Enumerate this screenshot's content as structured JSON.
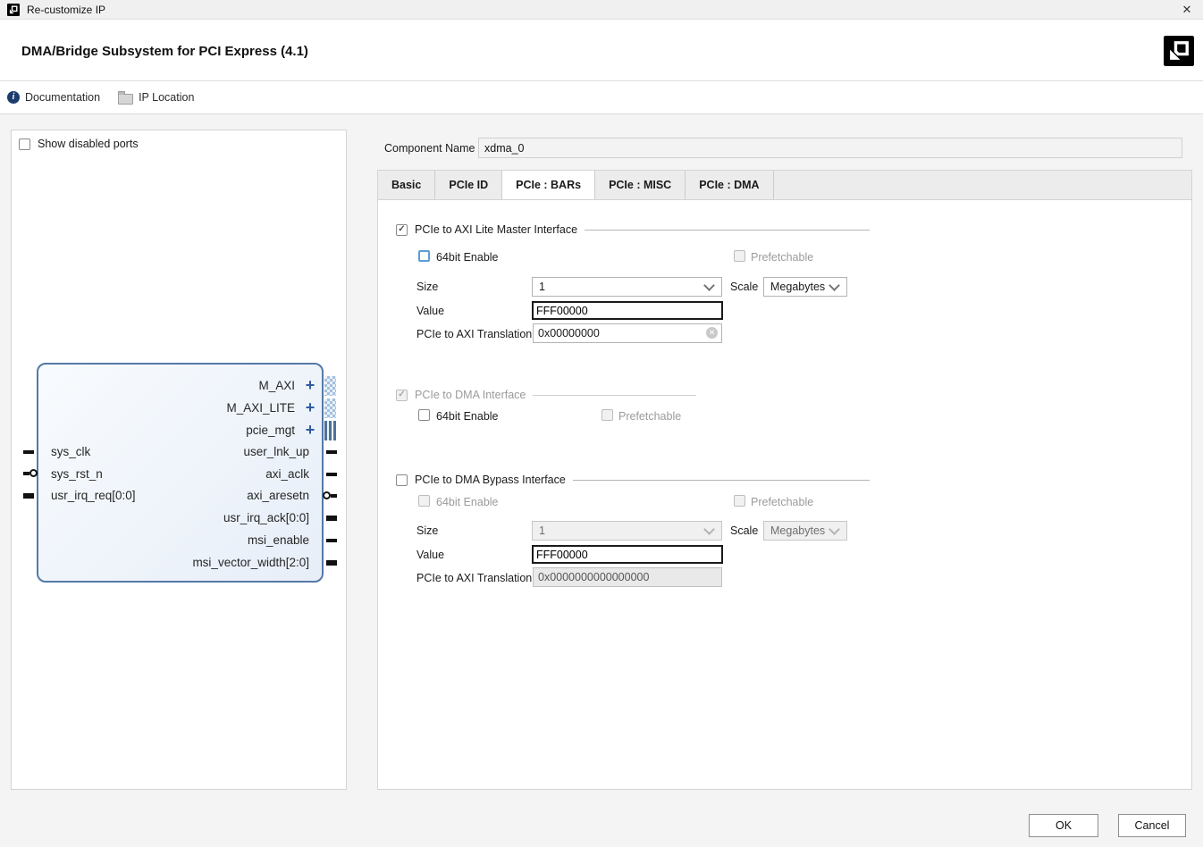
{
  "window": {
    "title": "Re-customize IP"
  },
  "header": {
    "title": "DMA/Bridge Subsystem for PCI Express (4.1)"
  },
  "toolbar": {
    "documentation": "Documentation",
    "ip_location": "IP Location"
  },
  "left_panel": {
    "show_disabled_ports": "Show disabled ports",
    "block": {
      "interfaces": [
        {
          "label": "M_AXI",
          "pin_icon": "interface-pins-dotted"
        },
        {
          "label": "M_AXI_LITE",
          "pin_icon": "interface-pins-dotted"
        },
        {
          "label": "pcie_mgt",
          "pin_icon": "interface-pins-bars"
        }
      ],
      "left_ports": [
        {
          "label": "sys_clk",
          "style": "thin"
        },
        {
          "label": "sys_rst_n",
          "style": "active-low"
        },
        {
          "label": "usr_irq_req[0:0]",
          "style": "bus"
        }
      ],
      "right_ports": [
        {
          "label": "user_lnk_up",
          "style": "thin"
        },
        {
          "label": "axi_aclk",
          "style": "thin"
        },
        {
          "label": "axi_aresetn",
          "style": "active-low"
        },
        {
          "label": "usr_irq_ack[0:0]",
          "style": "bus"
        },
        {
          "label": "msi_enable",
          "style": "thin"
        },
        {
          "label": "msi_vector_width[2:0]",
          "style": "bus"
        }
      ]
    }
  },
  "component_name": {
    "label": "Component Name",
    "value": "xdma_0"
  },
  "tabs": [
    {
      "label": "Basic",
      "selected": false
    },
    {
      "label": "PCIe ID",
      "selected": false
    },
    {
      "label": "PCIe : BARs",
      "selected": true
    },
    {
      "label": "PCIe : MISC",
      "selected": false
    },
    {
      "label": "PCIe : DMA",
      "selected": false
    }
  ],
  "sections": [
    {
      "title": "PCIe to AXI Lite Master Interface",
      "checkbox_state": "checked",
      "bit64_label": "64bit Enable",
      "prefetchable_label": "Prefetchable",
      "size_label": "Size",
      "size_value": "1",
      "scale_label": "Scale",
      "scale_value": "Megabytes",
      "value_label": "Value",
      "value": "FFF00000",
      "translation_label": "PCIe to AXI Translation",
      "translation_value": "0x00000000"
    },
    {
      "title": "PCIe to DMA Interface",
      "checkbox_state": "checked-disabled",
      "bit64_label": "64bit Enable",
      "prefetchable_label": "Prefetchable"
    },
    {
      "title": "PCIe to DMA Bypass Interface",
      "checkbox_state": "unchecked",
      "bit64_label": "64bit Enable",
      "prefetchable_label": "Prefetchable",
      "size_label": "Size",
      "size_value": "1",
      "scale_label": "Scale",
      "scale_value": "Megabytes",
      "value_label": "Value",
      "value": "FFF00000",
      "translation_label": "PCIe to AXI Translation",
      "translation_value": "0x0000000000000000"
    }
  ],
  "footer": {
    "ok": "OK",
    "cancel": "Cancel"
  },
  "icons": {
    "close": "✕",
    "check": "✓",
    "plus": "+",
    "clear": "✕",
    "info": "i"
  },
  "colors": {
    "accent_blue": "#2d5b9e",
    "block_border": "#5579a7",
    "block_fill": "#edf3fb",
    "focus_blue": "#5e9cd3",
    "tab_bg": "#ececec",
    "disabled_text": "#9b9b9b"
  }
}
